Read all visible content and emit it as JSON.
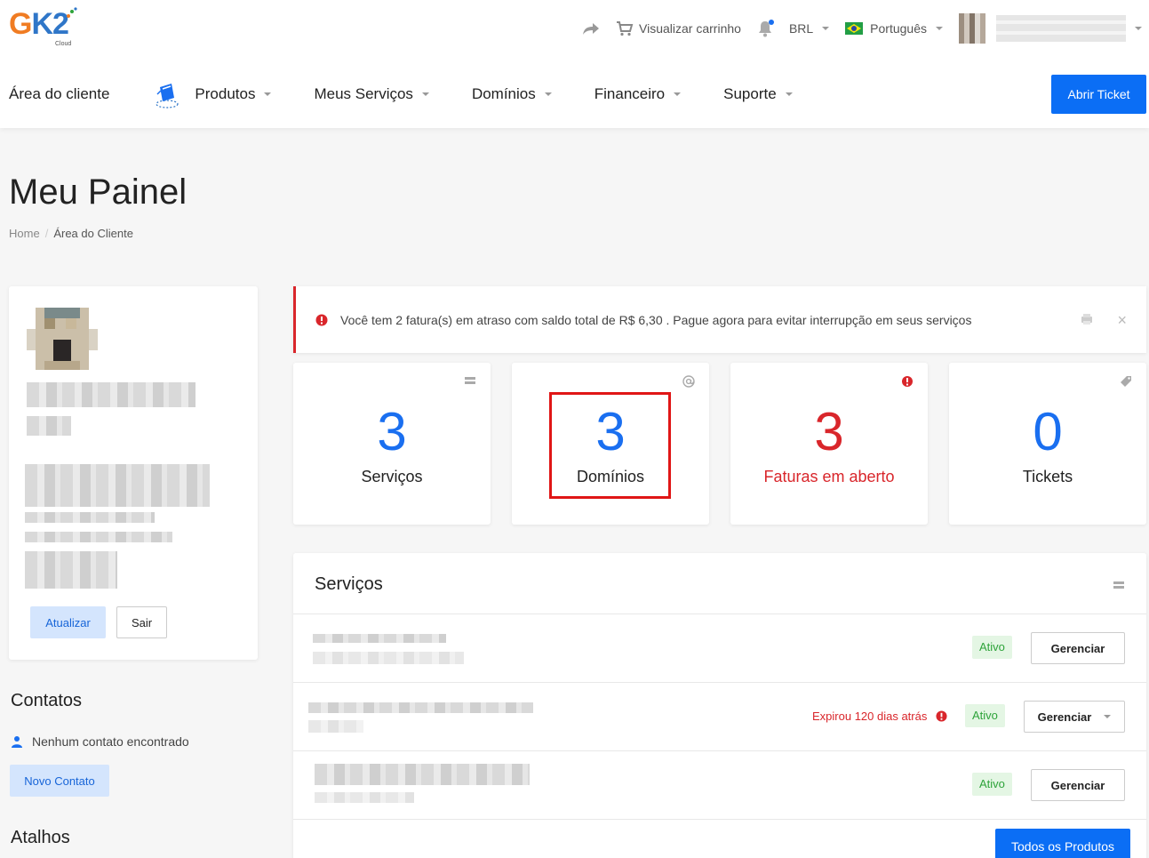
{
  "brand": {
    "logo_main": "GK2",
    "logo_sub": "Cloud",
    "colors": {
      "orange": "#f07c23",
      "blue": "#2f76c8"
    }
  },
  "utilities": {
    "share_icon": "share-arrow-icon",
    "cart_label": "Visualizar carrinho",
    "currency": "BRL",
    "language": "Português"
  },
  "nav": {
    "client_area": "Área do cliente",
    "items": [
      "Produtos",
      "Meus Serviços",
      "Domínios",
      "Financeiro",
      "Suporte"
    ],
    "open_ticket": "Abrir Ticket"
  },
  "header": {
    "title": "Meu Painel",
    "breadcrumb": {
      "home": "Home",
      "current": "Área do Cliente"
    }
  },
  "profile": {
    "update_label": "Atualizar",
    "logout_label": "Sair"
  },
  "contacts": {
    "title": "Contatos",
    "empty": "Nenhum contato encontrado",
    "new_label": "Novo Contato"
  },
  "shortcuts": {
    "title": "Atalhos"
  },
  "alert": {
    "text": "Você tem 2 fatura(s) em atraso com saldo total de R$ 6,30 . Pague agora para evitar interrupção em seus serviços",
    "close": "×"
  },
  "stats": [
    {
      "value": "3",
      "label": "Serviços",
      "icon": "server-icon"
    },
    {
      "value": "3",
      "label": "Domínios",
      "icon": "at-icon"
    },
    {
      "value": "3",
      "label": "Faturas em aberto",
      "icon": "alert-circle-icon"
    },
    {
      "value": "0",
      "label": "Tickets",
      "icon": "tag-icon"
    }
  ],
  "services": {
    "title": "Serviços",
    "rows": [
      {
        "status": "Ativo",
        "action": "Gerenciar"
      },
      {
        "status": "Ativo",
        "action": "Gerenciar",
        "note": "Expirou 120 dias atrás"
      },
      {
        "status": "Ativo",
        "action": "Gerenciar"
      }
    ],
    "all_products": "Todos os Produtos"
  }
}
